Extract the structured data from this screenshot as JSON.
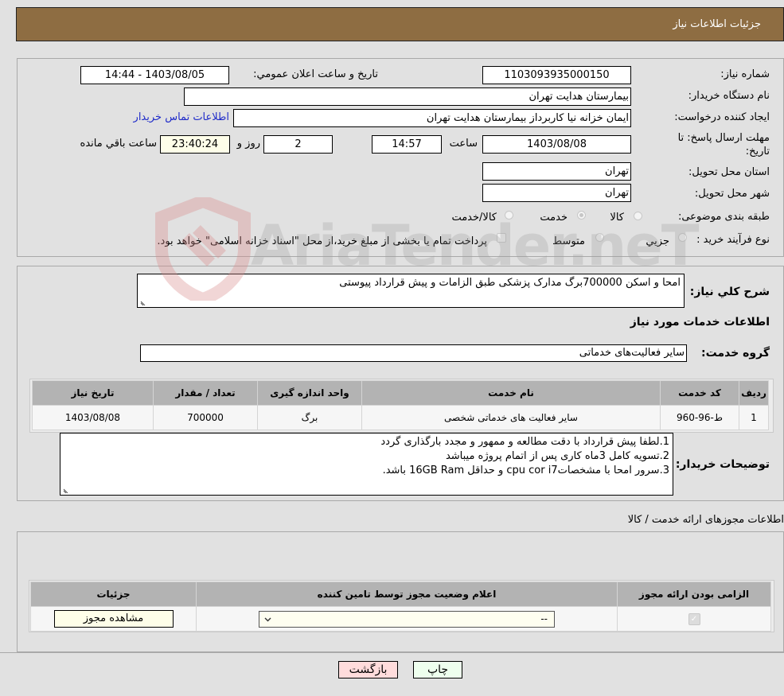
{
  "header": {
    "title": "جزئیات اطلاعات نیاز"
  },
  "form": {
    "need_number_label": "شماره نیاز:",
    "need_number": "1103093935000150",
    "announce_label": "تاریخ و ساعت اعلان عمومي:",
    "announce_value": "1403/08/05 - 14:44",
    "buyer_org_label": "نام دستگاه خریدار:",
    "buyer_org": "بیمارستان هدایت تهران",
    "creator_label": "ایجاد کننده درخواست:",
    "creator": "ایمان خزانه نیا کاربرداز بیمارستان هدایت تهران",
    "buyer_contact_link": "اطلاعات تماس خریدار",
    "deadline_label": "مهلت ارسال پاسخ: تا تاریخ:",
    "deadline_date": "1403/08/08",
    "time_label": "ساعت",
    "deadline_time": "14:57",
    "days_value": "2",
    "days_label": "روز و",
    "remaining_time": "23:40:24",
    "remaining_label": "ساعت باقي مانده",
    "province_label": "استان محل تحویل:",
    "province": "تهران",
    "city_label": "شهر محل تحویل:",
    "city": "تهران",
    "category_label": "طبقه بندی موضوعی:",
    "category_options": [
      {
        "label": "کالا",
        "selected": false
      },
      {
        "label": "خدمت",
        "selected": true
      },
      {
        "label": "کالا/خدمت",
        "selected": false
      }
    ],
    "process_label": "نوع فرآیند خرید :",
    "process_options": [
      {
        "label": "جزيي",
        "selected": false
      },
      {
        "label": "متوسط",
        "selected": false
      }
    ],
    "treasury_note": "پرداخت تمام یا بخشی از مبلغ خرید،از محل \"اسناد خزانه اسلامی\" خواهد بود."
  },
  "description": {
    "label": "شرح کلي نیاز:",
    "value": "امحا و اسکن 700000برگ مدارک پزشکی طبق الزامات و پیش قرارداد پیوستی"
  },
  "services": {
    "section_title": "اطلاعات خدمات مورد نیاز",
    "group_label": "گروه خدمت:",
    "group_value": "سایر فعالیت‌های خدماتی",
    "columns": [
      "ردیف",
      "کد خدمت",
      "نام خدمت",
      "واحد اندازه گیری",
      "تعداد / مقدار",
      "تاریخ نیاز"
    ],
    "rows": [
      {
        "index": "1",
        "code": "ط-96-960",
        "name": "سایر فعالیت های خدماتی شخصی",
        "unit": "برگ",
        "quantity": "700000",
        "date": "1403/08/08"
      }
    ]
  },
  "buyer_notes": {
    "label": "توضیحات خریدار:",
    "lines": [
      "1.لطفا پیش قرارداد با دقت مطالعه و ممهور و مجدد بارگذاری گردد",
      "2.تسویه کامل 3ماه کاری پس از اتمام پروژه میباشد",
      "3.سرور امحا با مشخصاتcpu cor i7 و حداقل 16GB Ram باشد."
    ]
  },
  "permits": {
    "section_title": "اطلاعات مجوزهای ارائه خدمت / کالا",
    "columns": [
      "الزامی بودن ارائه مجوز",
      "اعلام وضعیت مجوز توسط تامین کننده",
      "جزئیات"
    ],
    "rows": [
      {
        "required": true,
        "status_select": "--",
        "details_button": "مشاهده مجوز"
      }
    ]
  },
  "footer": {
    "print_button": "چاپ",
    "back_button": "بازگشت"
  },
  "watermark": {
    "text": "AriaTender.neT"
  }
}
